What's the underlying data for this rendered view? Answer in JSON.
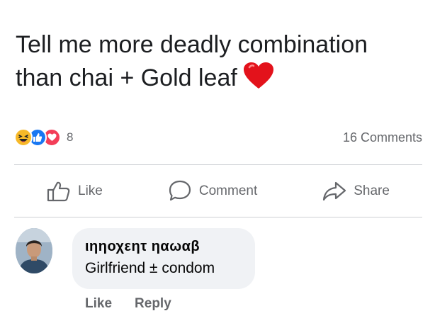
{
  "post": {
    "line1": "Tell me more deadly combination",
    "line2": "than chai + Gold leaf"
  },
  "reactions": {
    "icons": [
      "haha-icon",
      "like-icon",
      "love-icon"
    ],
    "count": "8",
    "comments": "16 Comments"
  },
  "actions": {
    "like": "Like",
    "comment": "Comment",
    "share": "Share"
  },
  "comment": {
    "author": "ιηηοχεητ ηαωαβ",
    "text": "Girlfriend ± condom",
    "like": "Like",
    "reply": "Reply"
  },
  "colors": {
    "like_blue": "#1877f2",
    "love_red": "#f33e58",
    "haha_yellow": "#f7b928",
    "muted_text": "#65676b",
    "bubble_bg": "#f0f2f5",
    "heart_red": "#e3121b"
  }
}
